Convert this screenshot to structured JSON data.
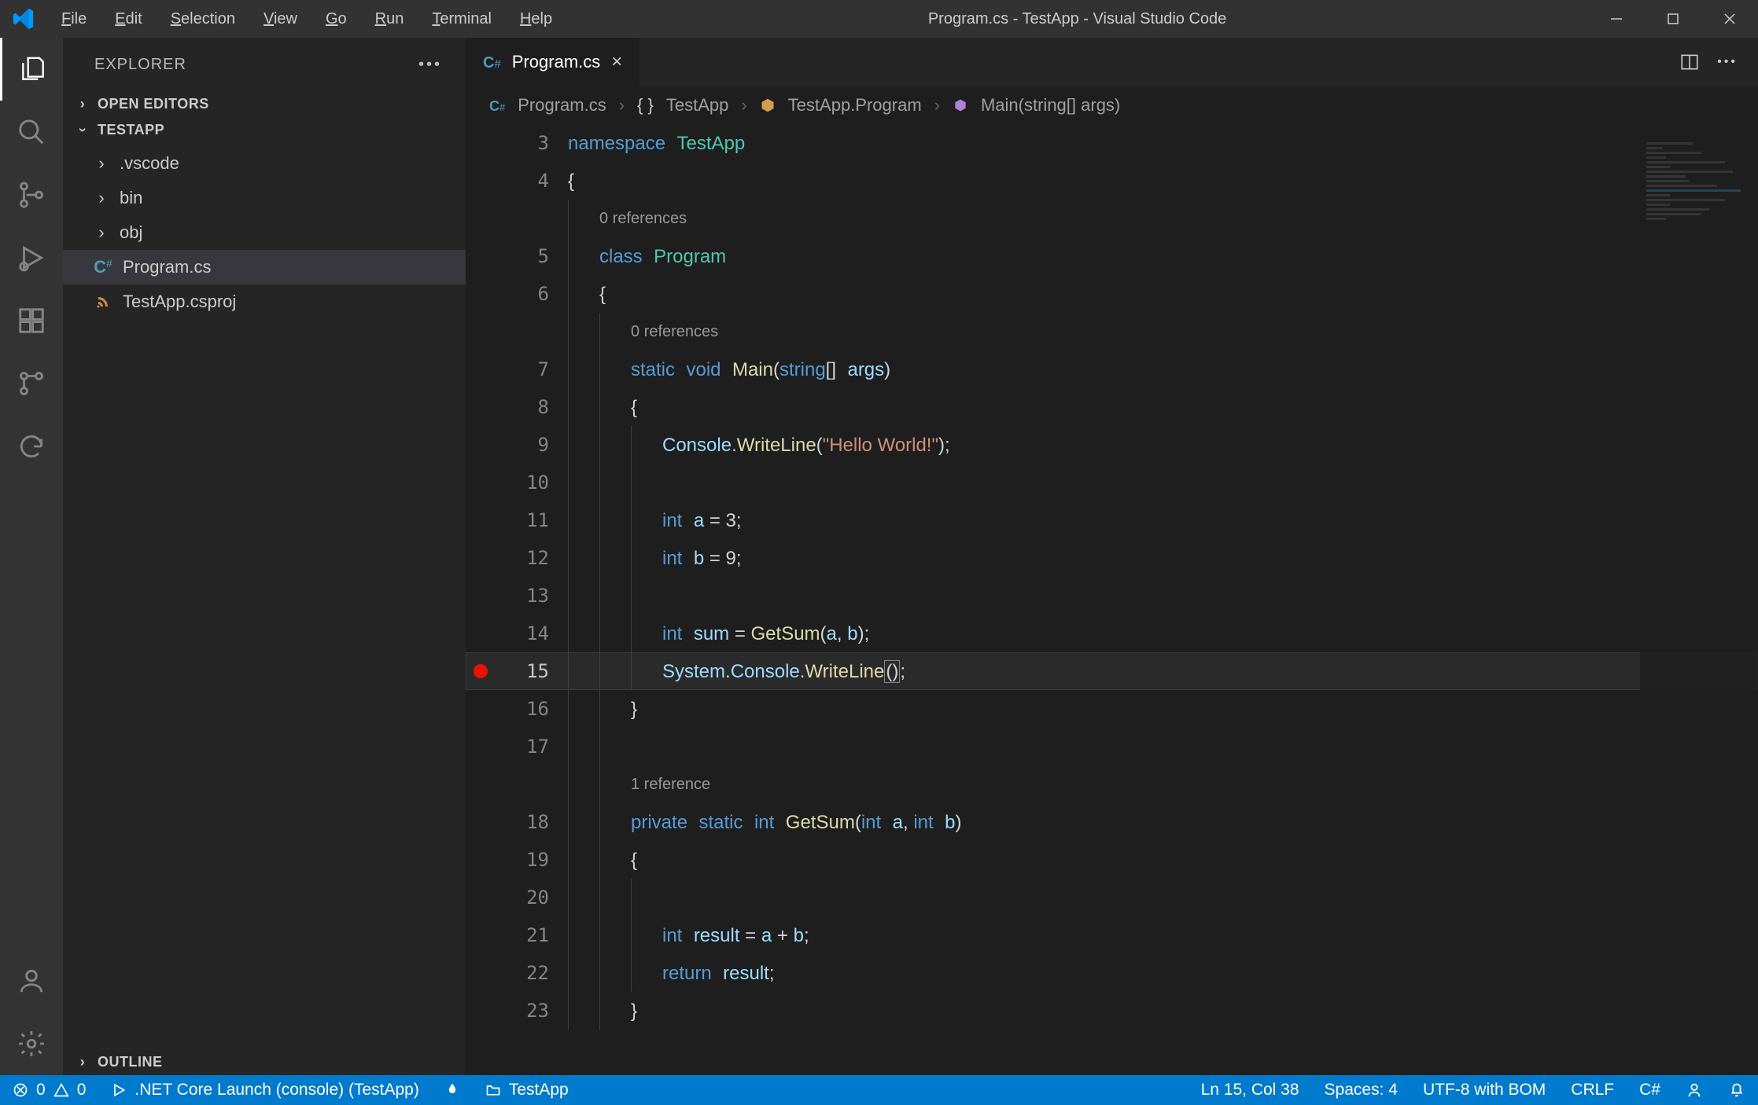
{
  "window": {
    "title": "Program.cs - TestApp - Visual Studio Code"
  },
  "menu": {
    "file": "File",
    "edit": "Edit",
    "selection": "Selection",
    "view": "View",
    "go": "Go",
    "run": "Run",
    "terminal": "Terminal",
    "help": "Help"
  },
  "sidebar": {
    "title": "EXPLORER",
    "open_editors": "OPEN EDITORS",
    "project": "TESTAPP",
    "folders": [
      ".vscode",
      "bin",
      "obj"
    ],
    "files": [
      {
        "icon": "csharp",
        "name": "Program.cs",
        "selected": true
      },
      {
        "icon": "rss",
        "name": "TestApp.csproj",
        "selected": false
      }
    ],
    "outline": "OUTLINE"
  },
  "tab": {
    "name": "Program.cs"
  },
  "breadcrumbs": {
    "file": "Program.cs",
    "ns": "TestApp",
    "class": "TestApp.Program",
    "method": "Main(string[] args)"
  },
  "codelens": {
    "zero": "0 references",
    "one": "1 reference"
  },
  "code": {
    "l3": {
      "no": "3"
    },
    "l4": {
      "no": "4"
    },
    "l5": {
      "no": "5"
    },
    "l6": {
      "no": "6"
    },
    "l7": {
      "no": "7"
    },
    "l8": {
      "no": "8"
    },
    "l9": {
      "no": "9"
    },
    "l10": {
      "no": "10"
    },
    "l11": {
      "no": "11"
    },
    "l12": {
      "no": "12"
    },
    "l13": {
      "no": "13"
    },
    "l14": {
      "no": "14"
    },
    "l15": {
      "no": "15"
    },
    "l16": {
      "no": "16"
    },
    "l17": {
      "no": "17"
    },
    "l18": {
      "no": "18"
    },
    "l19": {
      "no": "19"
    },
    "l20": {
      "no": "20"
    },
    "l21": {
      "no": "21"
    },
    "l22": {
      "no": "22"
    },
    "l23": {
      "no": "23"
    }
  },
  "tokens": {
    "namespace": "namespace",
    "TestApp": "TestApp",
    "class": "class",
    "Program": "Program",
    "static": "static",
    "void": "void",
    "Main": "Main",
    "string": "string",
    "args": "args",
    "Console": "Console",
    "WriteLine": "WriteLine",
    "hello": "\"Hello World!\"",
    "int": "int",
    "a": "a",
    "b": "b",
    "eq": " = ",
    "three": "3",
    "nine": "9",
    "semi": ";",
    "sum": "sum",
    "GetSum": "GetSum",
    "System": "System",
    "private": "private",
    "result": "result",
    "plus": " + ",
    "return": "return",
    "lbrace": "{",
    "rbrace": "}",
    "lpar": "(",
    "rpar": ")",
    "lbrk": "[]",
    ", ": ", "
  },
  "status": {
    "errors": "0",
    "warnings": "0",
    "launch": ".NET Core Launch (console) (TestApp)",
    "folder": "TestApp",
    "pos": "Ln 15, Col 38",
    "spaces": "Spaces: 4",
    "encoding": "UTF-8 with BOM",
    "eol": "CRLF",
    "lang": "C#"
  }
}
